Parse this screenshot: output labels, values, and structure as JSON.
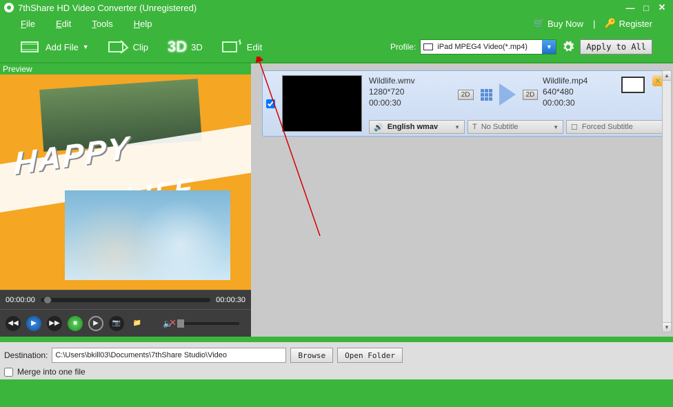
{
  "titlebar": {
    "title": "7thShare HD Video Converter (Unregistered)"
  },
  "menubar": {
    "file": "File",
    "edit": "Edit",
    "tools": "Tools",
    "help": "Help",
    "buy_now": "Buy Now",
    "register": "Register"
  },
  "toolbar": {
    "add_file": "Add File",
    "clip": "Clip",
    "threeD": "3D",
    "threeD_label": "3D",
    "edit": "Edit",
    "profile_label": "Profile:",
    "profile_value": "iPad MPEG4 Video(*.mp4)",
    "apply_all": "Apply to All"
  },
  "preview": {
    "label": "Preview",
    "overlay_text_1": "HAPPY",
    "overlay_text_2": "LIFE",
    "time_current": "00:00:00",
    "time_total": "00:00:30"
  },
  "file_item": {
    "src_name": "Wildlife.wmv",
    "src_res": "1280*720",
    "src_dur": "00:00:30",
    "out_name": "Wildlife.mp4",
    "out_res": "640*480",
    "out_dur": "00:00:30",
    "badge_in": "2D",
    "badge_out": "2D",
    "audio": "English wmav",
    "subtitle_none": "No Subtitle",
    "subtitle_forced": "Forced Subtitle",
    "checked": true
  },
  "destination": {
    "label": "Destination:",
    "path": "C:\\Users\\bkill03\\Documents\\7thShare Studio\\Video",
    "browse": "Browse",
    "open_folder": "Open Folder",
    "merge": "Merge into one file"
  }
}
